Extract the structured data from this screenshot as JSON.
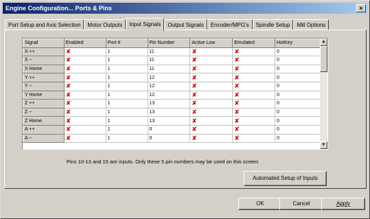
{
  "window": {
    "title": "Engine Configuration... Ports & Pins",
    "close": "×"
  },
  "tabs": [
    "Port Setup and Axis Selection",
    "Motor Outputs",
    "Input Signals",
    "Output Signals",
    "Encoder/MPG's",
    "Spindle Setup",
    "Mill Options"
  ],
  "table": {
    "headers": [
      "Signal",
      "Enabled",
      "Port #",
      "Pin Number",
      "Active Low",
      "Emulated",
      "HotKey"
    ],
    "rows": [
      [
        "X ++",
        "✘",
        "1",
        "11",
        "✘",
        "✘",
        "0"
      ],
      [
        "X --",
        "✘",
        "1",
        "11",
        "✘",
        "✘",
        "0"
      ],
      [
        "X Home",
        "✘",
        "1",
        "11",
        "✘",
        "✘",
        "0"
      ],
      [
        "Y ++",
        "✘",
        "1",
        "12",
        "✘",
        "✘",
        "0"
      ],
      [
        "Y --",
        "✘",
        "1",
        "12",
        "✘",
        "✘",
        "0"
      ],
      [
        "Y Home",
        "✘",
        "1",
        "12",
        "✘",
        "✘",
        "0"
      ],
      [
        "Z ++",
        "✘",
        "1",
        "13",
        "✘",
        "✘",
        "0"
      ],
      [
        "Z --",
        "✘",
        "1",
        "13",
        "✘",
        "✘",
        "0"
      ],
      [
        "Z Home",
        "✘",
        "1",
        "13",
        "✘",
        "✘",
        "0"
      ],
      [
        "A ++",
        "✘",
        "1",
        "0",
        "✘",
        "✘",
        "0"
      ],
      [
        "A --",
        "✘",
        "1",
        "0",
        "✘",
        "✘",
        "0"
      ]
    ]
  },
  "note": "Pins 10-13 and 15 are inputs. Only these 5 pin numbers may be used on this screen",
  "buttons": {
    "auto_setup": "Automated Setup of Inputs",
    "ok": "OK",
    "cancel": "Cancel",
    "apply": "Apply"
  },
  "icons": {
    "disabled_mark": "red-x-icon",
    "scroll_up": "▲",
    "scroll_down": "▼"
  },
  "colors": {
    "title_start": "#0a246a",
    "title_end": "#a6caf0",
    "x_mark": "#cc0000",
    "face": "#d4d0c8"
  }
}
